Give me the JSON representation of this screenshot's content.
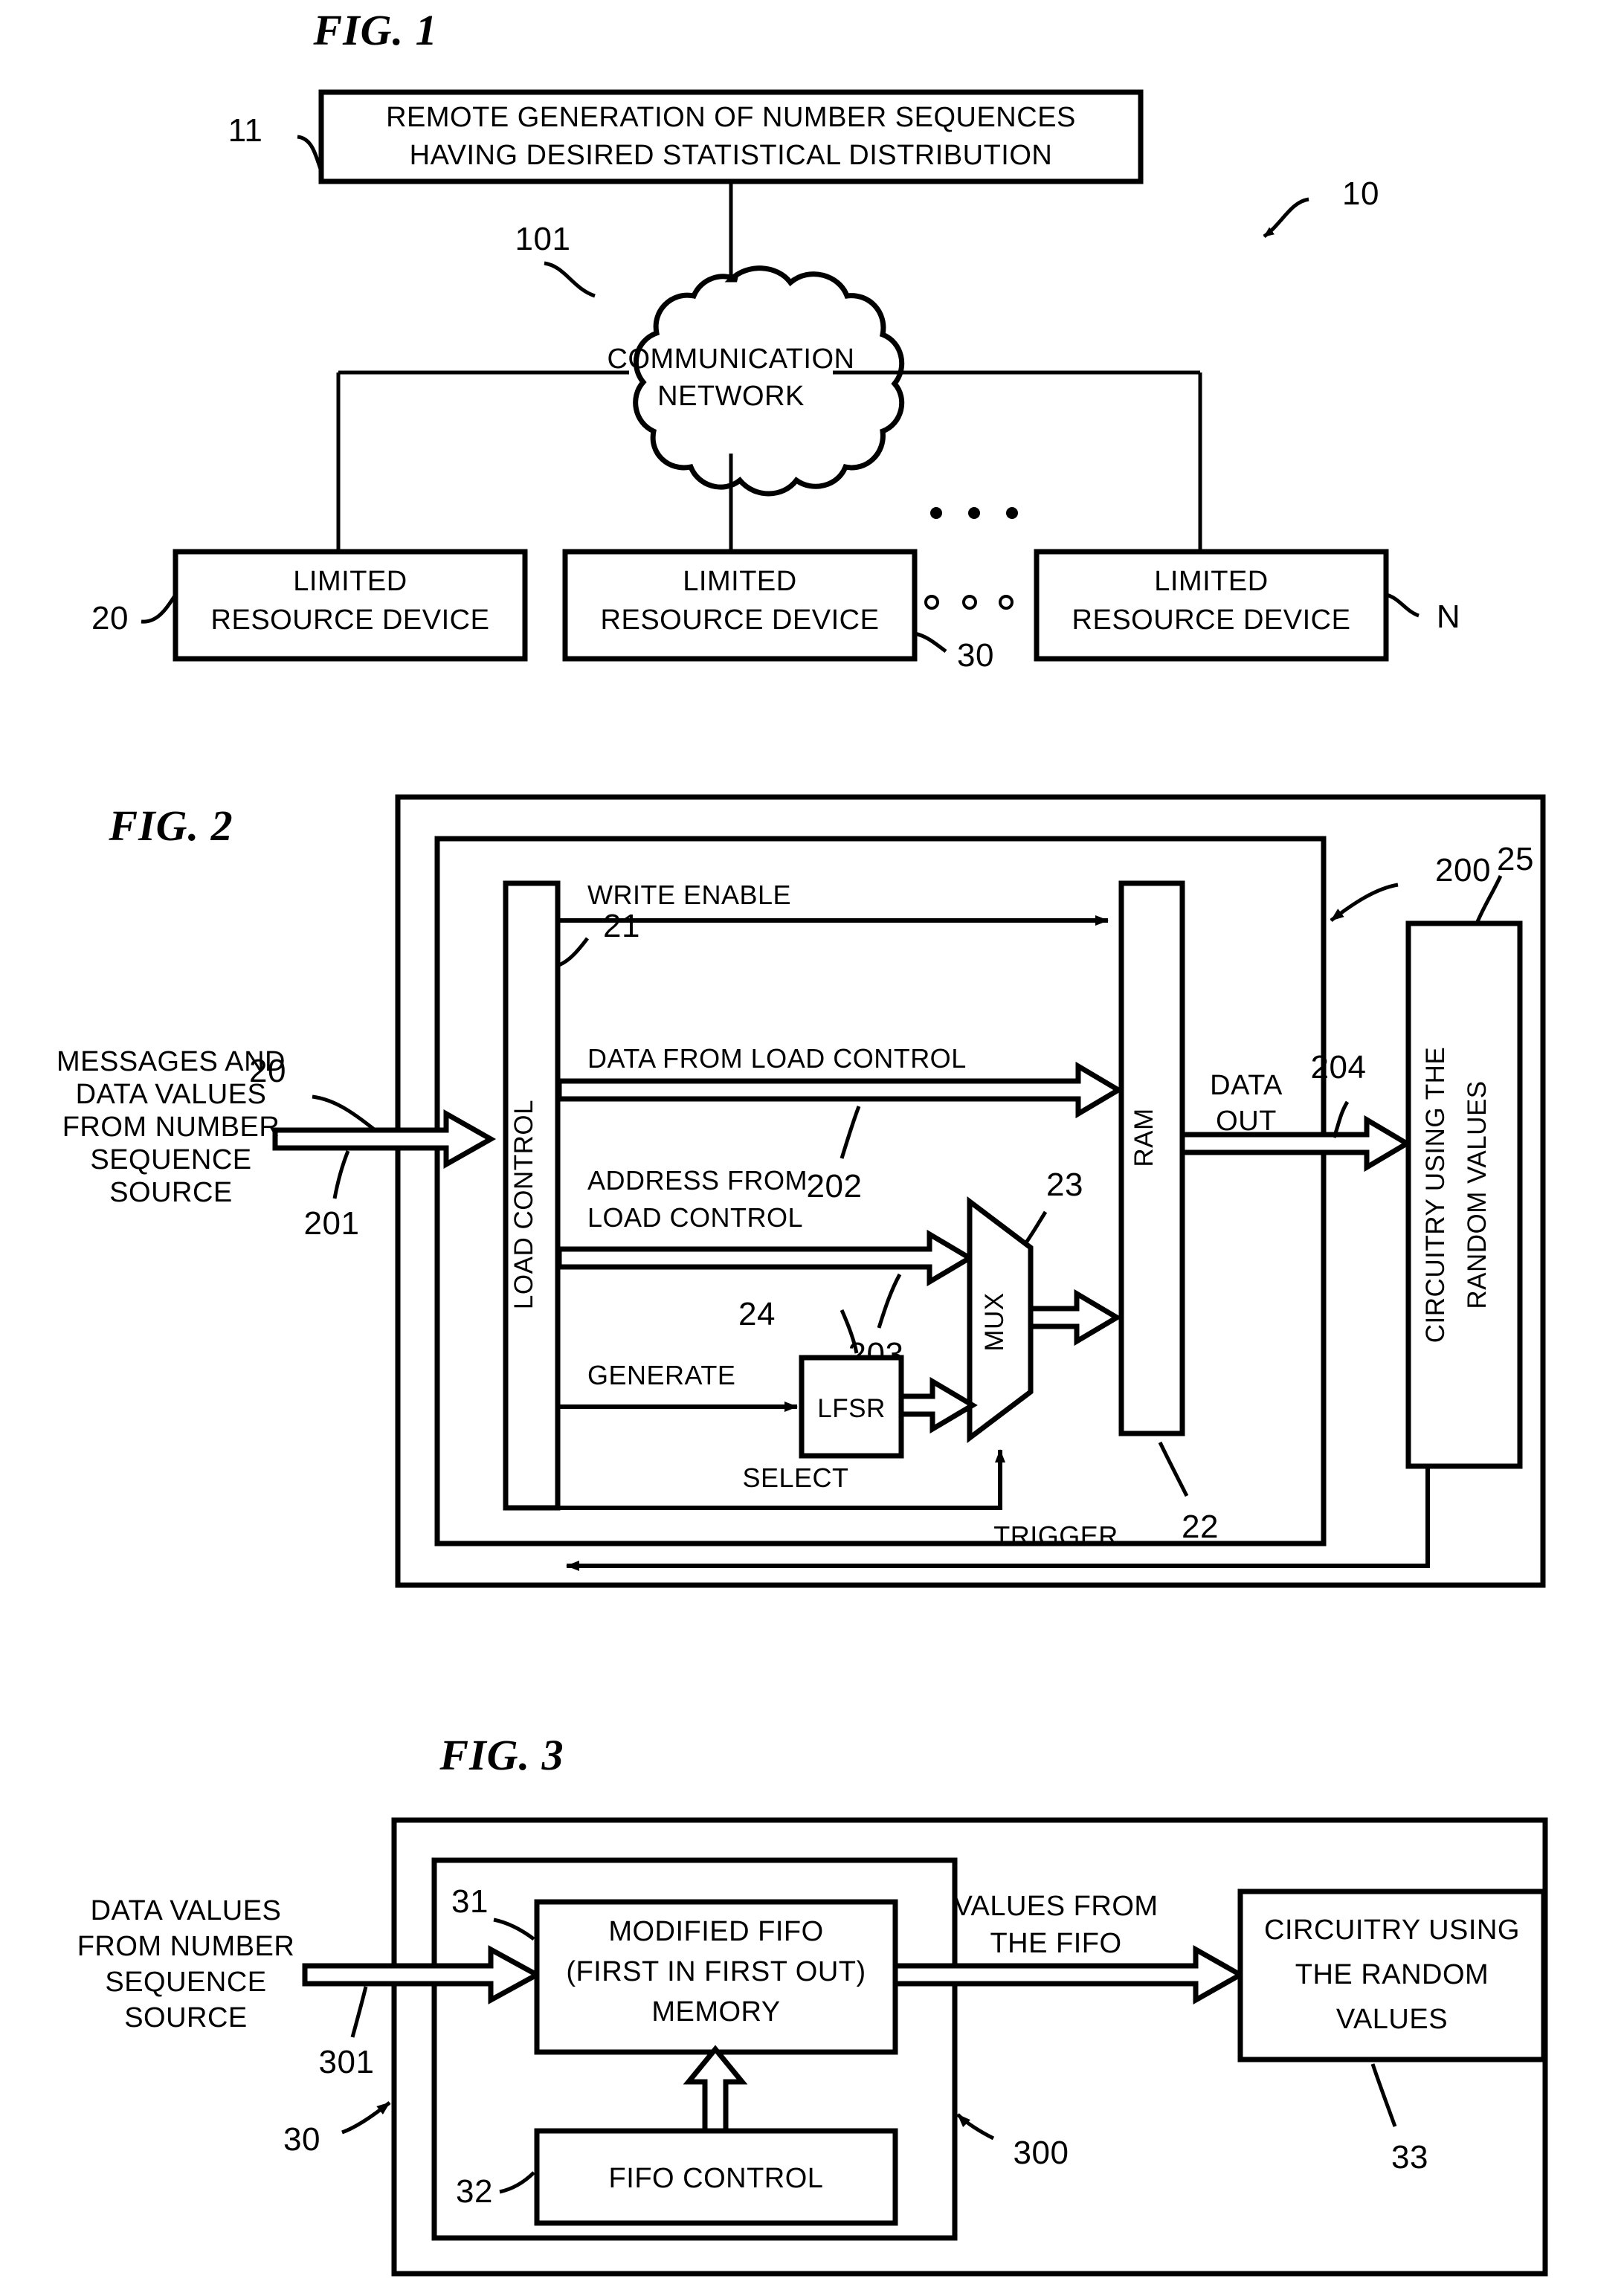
{
  "document": {
    "type": "patent-drawing-sheet",
    "background_color": "#ffffff",
    "line_color": "#000000"
  },
  "fig1": {
    "title": "FIG. 1",
    "system_ref": "10",
    "top_box": {
      "ref": "11",
      "line1": "REMOTE GENERATION OF NUMBER SEQUENCES",
      "line2": "HAVING DESIRED STATISTICAL DISTRIBUTION"
    },
    "cloud": {
      "ref": "101",
      "line1": "COMMUNICATION",
      "line2": "NETWORK"
    },
    "devices": [
      {
        "ref": "20",
        "line1": "LIMITED",
        "line2": "RESOURCE DEVICE"
      },
      {
        "ref": "30",
        "line1": "LIMITED",
        "line2": "RESOURCE DEVICE"
      },
      {
        "ref": "N",
        "line1": "LIMITED",
        "line2": "RESOURCE DEVICE"
      }
    ],
    "ellipsis_upper": "• • •",
    "ellipsis_lower": "o o o"
  },
  "fig2": {
    "title": "FIG. 2",
    "device_ref": "20",
    "inner_ref": "200",
    "input_label": {
      "line1": "MESSAGES AND",
      "line2": "DATA VALUES",
      "line3": "FROM NUMBER",
      "line4": "SEQUENCE",
      "line5": "SOURCE",
      "ref": "201"
    },
    "load_control": {
      "label": "LOAD CONTROL",
      "ref": "21"
    },
    "ram": {
      "label": "RAM",
      "ref": "22"
    },
    "mux": {
      "label": "MUX",
      "ref": "23"
    },
    "lfsr": {
      "label": "LFSR",
      "ref": "24"
    },
    "consumer": {
      "line1": "CIRCUITRY USING THE",
      "line2": "RANDOM VALUES",
      "ref": "25"
    },
    "signals": {
      "write_enable": "WRITE ENABLE",
      "data_from_load_control": "DATA FROM LOAD CONTROL",
      "data_ref": "202",
      "address_from_load_control_l1": "ADDRESS FROM",
      "address_from_load_control_l2": "LOAD CONTROL",
      "address_ref": "203",
      "generate": "GENERATE",
      "select": "SELECT",
      "trigger": "TRIGGER",
      "data_out_l1": "DATA",
      "data_out_l2": "OUT",
      "data_out_ref": "204"
    }
  },
  "fig3": {
    "title": "FIG. 3",
    "device_ref": "30",
    "inner_ref": "300",
    "input_label": {
      "line1": "DATA VALUES",
      "line2": "FROM NUMBER",
      "line3": "SEQUENCE",
      "line4": "SOURCE",
      "ref": "301"
    },
    "fifo": {
      "ref": "31",
      "line1": "MODIFIED FIFO",
      "line2": "(FIRST IN FIRST OUT)",
      "line3": "MEMORY"
    },
    "fifo_control": {
      "ref": "32",
      "label": "FIFO CONTROL"
    },
    "consumer": {
      "ref": "33",
      "line1": "CIRCUITRY USING",
      "line2": "THE RANDOM",
      "line3": "VALUES"
    },
    "output_label": {
      "line1": "VALUES FROM",
      "line2": "THE FIFO"
    }
  }
}
